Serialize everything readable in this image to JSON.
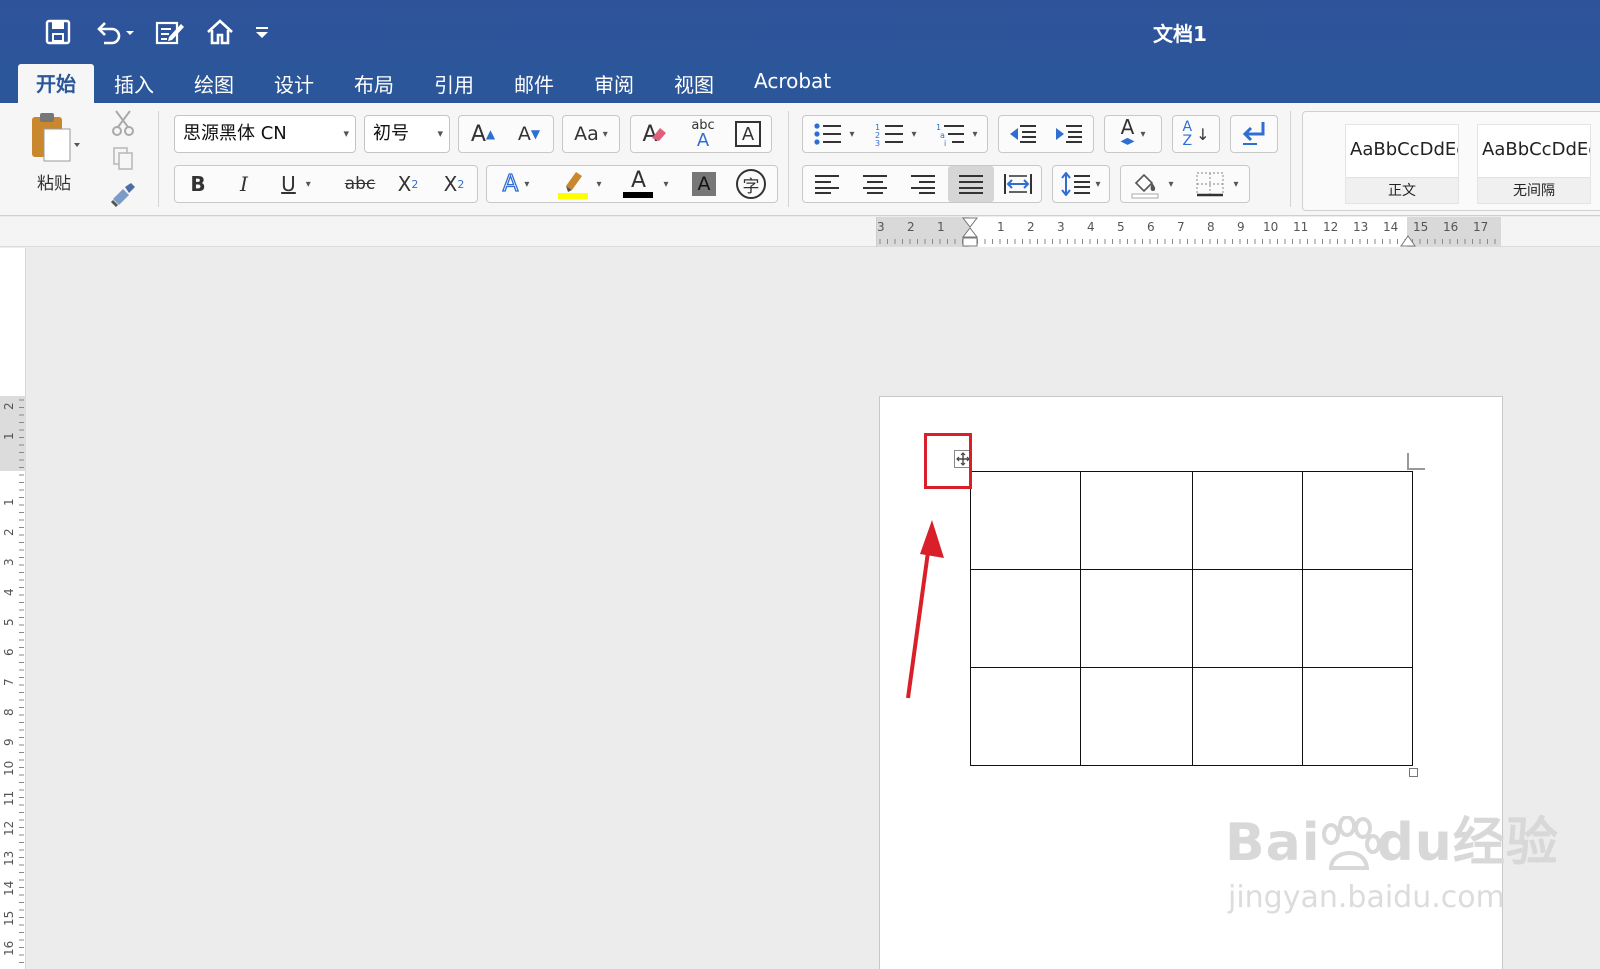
{
  "window": {
    "title": "文档1"
  },
  "quick_access": [
    {
      "id": "save",
      "icon": "save-icon"
    },
    {
      "id": "undo",
      "icon": "undo-icon"
    },
    {
      "id": "edit",
      "icon": "edit-document-icon"
    },
    {
      "id": "home",
      "icon": "home-icon"
    },
    {
      "id": "customize",
      "icon": "customize-qat-icon"
    }
  ],
  "tabs": [
    {
      "label": "开始",
      "active": true
    },
    {
      "label": "插入"
    },
    {
      "label": "绘图"
    },
    {
      "label": "设计"
    },
    {
      "label": "布局"
    },
    {
      "label": "引用"
    },
    {
      "label": "邮件"
    },
    {
      "label": "审阅"
    },
    {
      "label": "视图"
    },
    {
      "label": "Acrobat"
    }
  ],
  "ribbon": {
    "paste_label": "粘贴",
    "font_name": "思源黑体 CN",
    "font_size": "初号",
    "bold": "B",
    "italic": "I",
    "underline": "U",
    "strike": "abc",
    "sub": "X",
    "sub_mark": "2",
    "sup": "X",
    "sup_mark": "2",
    "text_effects": "A",
    "font_color": "A",
    "char_shading": "A",
    "enclose_char": "字",
    "grow": "A",
    "shrink": "A",
    "change_case": "Aa",
    "clear_format": "A",
    "phonetic": "abc",
    "phonetic_a": "A",
    "char_border": "A",
    "sort": "A",
    "sort_z": "Z",
    "para_text_dir": "A"
  },
  "styles": [
    {
      "sample": "AaBbCcDdEe",
      "name": "正文"
    },
    {
      "sample": "AaBbCcDdEe",
      "name": "无间隔"
    }
  ],
  "ruler": {
    "left_numbers": [
      "3",
      "2",
      "1"
    ],
    "right_numbers": [
      "1",
      "2",
      "3",
      "4",
      "5",
      "6",
      "7",
      "8",
      "9",
      "10",
      "11",
      "12",
      "13",
      "14",
      "15",
      "16",
      "17"
    ],
    "vertical_top": [
      "2",
      "1"
    ],
    "vertical_numbers": [
      "1",
      "2",
      "3",
      "4",
      "5",
      "6",
      "7",
      "8",
      "9",
      "10",
      "11",
      "12",
      "13",
      "14",
      "15",
      "16"
    ]
  },
  "table": {
    "rows": 3,
    "cols": 4
  },
  "colors": {
    "titlebar": "#2b579a",
    "highlight": "#ffff00",
    "annotation_red": "#d9202a"
  },
  "watermark": {
    "logo": "Bai",
    "logo_paw": "du",
    "brand": "经验",
    "url": "jingyan.baidu.com"
  }
}
